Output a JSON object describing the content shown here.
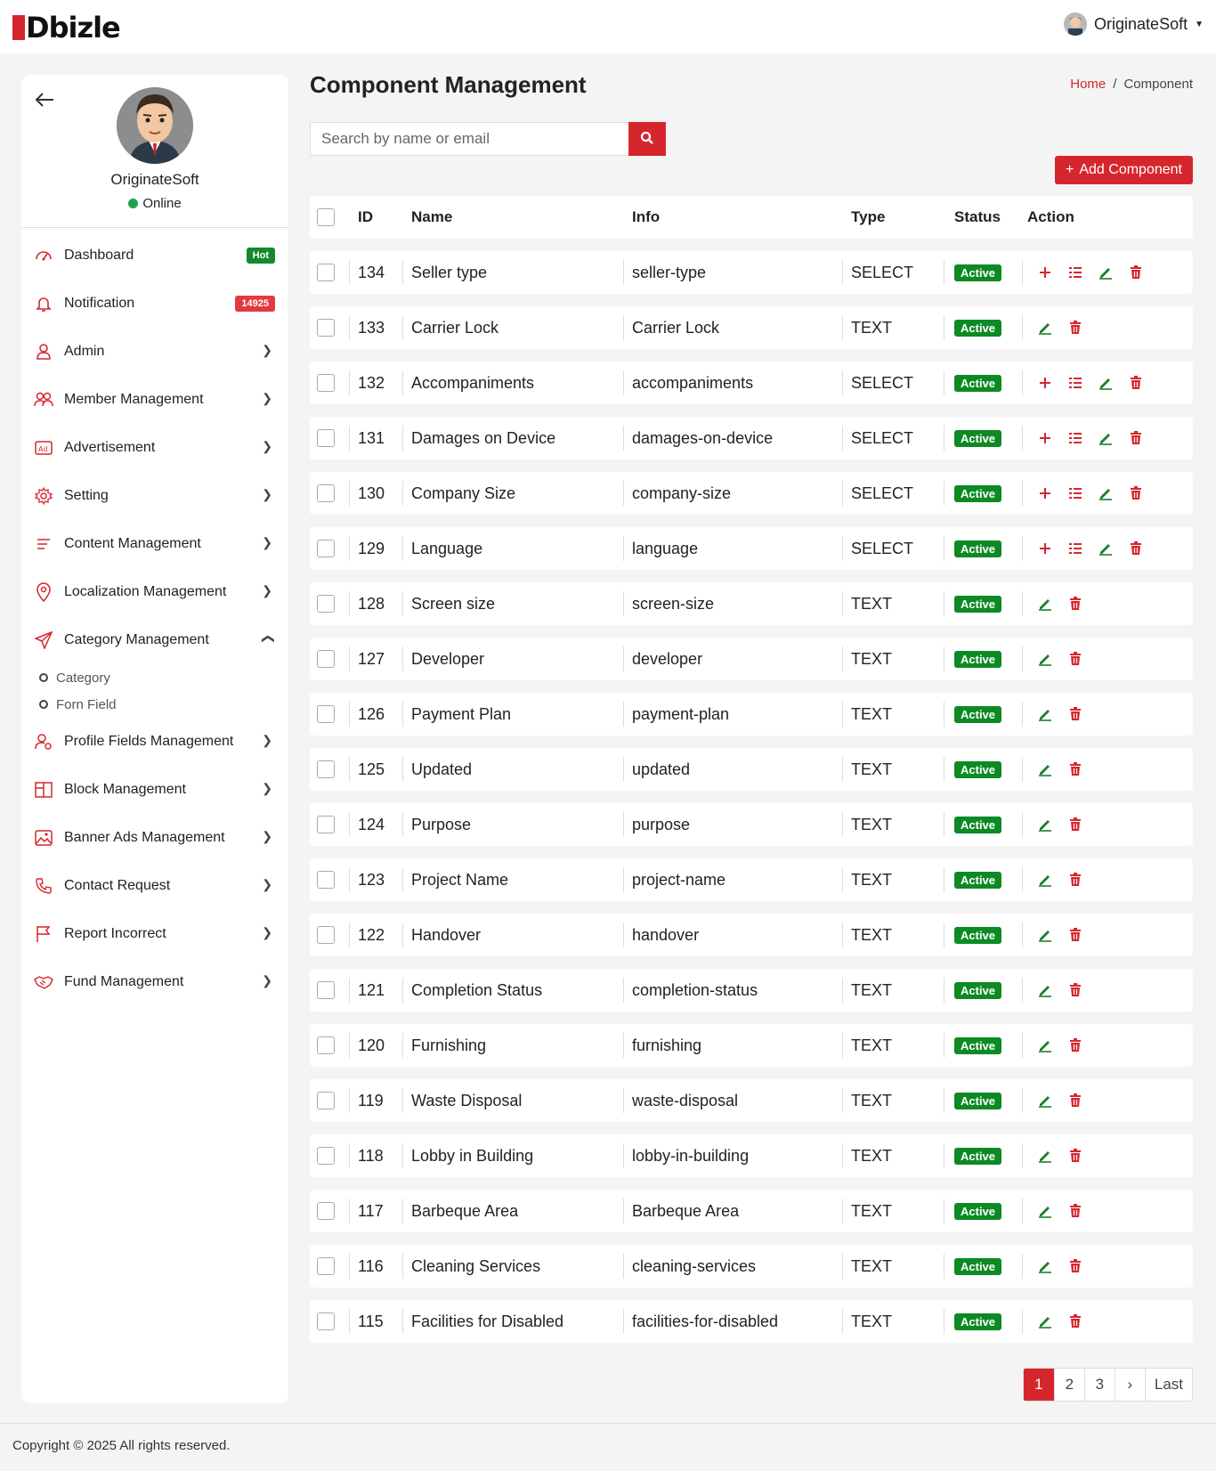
{
  "header": {
    "logo_text": "Dbizle",
    "user_name": "OriginateSoft"
  },
  "sidebar": {
    "profile_name": "OriginateSoft",
    "profile_status": "Online",
    "items": [
      {
        "label": "Dashboard",
        "badge": "Hot",
        "icon": "dashboard-icon"
      },
      {
        "label": "Notification",
        "badge": "14925",
        "icon": "bell-icon"
      },
      {
        "label": "Admin",
        "icon": "user-icon"
      },
      {
        "label": "Member Management",
        "icon": "users-icon"
      },
      {
        "label": "Advertisement",
        "icon": "ad-icon"
      },
      {
        "label": "Setting",
        "icon": "gear-icon"
      },
      {
        "label": "Content Management",
        "icon": "list-icon"
      },
      {
        "label": "Localization Management",
        "icon": "map-pin-icon"
      },
      {
        "label": "Category Management",
        "icon": "send-icon"
      },
      {
        "label": "Profile Fields Management",
        "icon": "user-gear-icon"
      },
      {
        "label": "Block Management",
        "icon": "block-icon"
      },
      {
        "label": "Banner Ads Management",
        "icon": "image-icon"
      },
      {
        "label": "Contact Request",
        "icon": "phone-icon"
      },
      {
        "label": "Report Incorrect",
        "icon": "flag-icon"
      },
      {
        "label": "Fund Management",
        "icon": "handshake-icon"
      }
    ],
    "sub_items": [
      "Category",
      "Forn Field"
    ]
  },
  "main": {
    "title": "Component Management",
    "breadcrumb": {
      "home": "Home",
      "sep": "/",
      "current": "Component"
    },
    "search_placeholder": "Search by name or email",
    "add_button": "Add Component",
    "columns": {
      "id": "ID",
      "name": "Name",
      "info": "Info",
      "type": "Type",
      "status": "Status",
      "action": "Action"
    },
    "rows": [
      {
        "id": "134",
        "name": "Seller type",
        "info": "seller-type",
        "type": "SELECT",
        "status": "Active"
      },
      {
        "id": "133",
        "name": "Carrier Lock",
        "info": "Carrier Lock",
        "type": "TEXT",
        "status": "Active"
      },
      {
        "id": "132",
        "name": "Accompaniments",
        "info": "accompaniments",
        "type": "SELECT",
        "status": "Active"
      },
      {
        "id": "131",
        "name": "Damages on Device",
        "info": "damages-on-device",
        "type": "SELECT",
        "status": "Active"
      },
      {
        "id": "130",
        "name": "Company Size",
        "info": "company-size",
        "type": "SELECT",
        "status": "Active"
      },
      {
        "id": "129",
        "name": "Language",
        "info": "language",
        "type": "SELECT",
        "status": "Active"
      },
      {
        "id": "128",
        "name": "Screen size",
        "info": "screen-size",
        "type": "TEXT",
        "status": "Active"
      },
      {
        "id": "127",
        "name": "Developer",
        "info": "developer",
        "type": "TEXT",
        "status": "Active"
      },
      {
        "id": "126",
        "name": "Payment Plan",
        "info": "payment-plan",
        "type": "TEXT",
        "status": "Active"
      },
      {
        "id": "125",
        "name": "Updated",
        "info": "updated",
        "type": "TEXT",
        "status": "Active"
      },
      {
        "id": "124",
        "name": "Purpose",
        "info": "purpose",
        "type": "TEXT",
        "status": "Active"
      },
      {
        "id": "123",
        "name": "Project Name",
        "info": "project-name",
        "type": "TEXT",
        "status": "Active"
      },
      {
        "id": "122",
        "name": "Handover",
        "info": "handover",
        "type": "TEXT",
        "status": "Active"
      },
      {
        "id": "121",
        "name": "Completion Status",
        "info": "completion-status",
        "type": "TEXT",
        "status": "Active"
      },
      {
        "id": "120",
        "name": "Furnishing",
        "info": "furnishing",
        "type": "TEXT",
        "status": "Active"
      },
      {
        "id": "119",
        "name": "Waste Disposal",
        "info": "waste-disposal",
        "type": "TEXT",
        "status": "Active"
      },
      {
        "id": "118",
        "name": "Lobby in Building",
        "info": "lobby-in-building",
        "type": "TEXT",
        "status": "Active"
      },
      {
        "id": "117",
        "name": "Barbeque Area",
        "info": "Barbeque Area",
        "type": "TEXT",
        "status": "Active"
      },
      {
        "id": "116",
        "name": "Cleaning Services",
        "info": "cleaning-services",
        "type": "TEXT",
        "status": "Active"
      },
      {
        "id": "115",
        "name": "Facilities for Disabled",
        "info": "facilities-for-disabled",
        "type": "TEXT",
        "status": "Active"
      }
    ],
    "pagination": {
      "pages": [
        "1",
        "2",
        "3"
      ],
      "next": "›",
      "last": "Last",
      "current": "1"
    }
  },
  "footer": {
    "text": "Copyright © 2025 All rights reserved."
  },
  "colors": {
    "brand": "#d6262d",
    "active": "#0d8a24",
    "edit": "#1a7f2e",
    "delete": "#d6262d"
  }
}
